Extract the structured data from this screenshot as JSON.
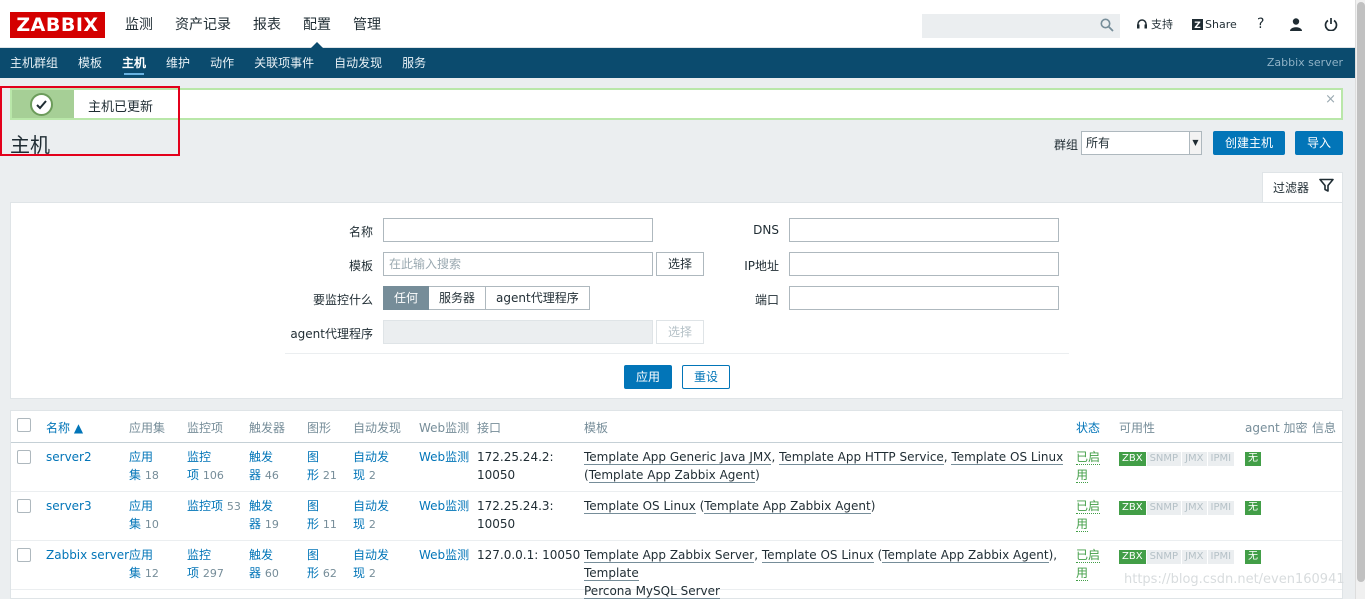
{
  "logo": "ZABBIX",
  "main_menu": [
    "监测",
    "资产记录",
    "报表",
    "配置",
    "管理"
  ],
  "search": {
    "placeholder": ""
  },
  "top_right": {
    "support": "支持",
    "share": "Share",
    "help": "?"
  },
  "sub_menu": [
    "主机群组",
    "模板",
    "主机",
    "维护",
    "动作",
    "关联项事件",
    "自动发现",
    "服务"
  ],
  "server_name": "Zabbix server",
  "message": {
    "text": "主机已更新",
    "close": "×"
  },
  "page": {
    "title": "主机",
    "group_label": "群组",
    "group_value": "所有",
    "create_button": "创建主机",
    "import_button": "导入"
  },
  "filter": {
    "tab_label": "过滤器",
    "name_label": "名称",
    "template_label": "模板",
    "template_placeholder": "在此输入搜索",
    "select_label": "选择",
    "monitored_by_label": "要监控什么",
    "monitored_by_options": [
      "任何",
      "服务器",
      "agent代理程序"
    ],
    "proxy_label": "agent代理程序",
    "dns_label": "DNS",
    "ip_label": "IP地址",
    "port_label": "端口",
    "apply": "应用",
    "reset": "重设"
  },
  "table": {
    "headers": {
      "name": "名称 ▲",
      "apps": "应用集",
      "items": "监控项",
      "triggers": "触发器",
      "graphs": "图形",
      "discovery": "自动发现",
      "web": "Web监测",
      "interface": "接口",
      "templates": "模板",
      "status": "状态",
      "availability": "可用性",
      "encryption": "agent 加密",
      "info": "信息"
    },
    "rows": [
      {
        "name": "server2",
        "apps_a": "应用",
        "apps_b": "集",
        "apps_count": "18",
        "items_a": "监控",
        "items_b": "项",
        "items_count": "106",
        "triggers_a": "触发",
        "triggers_b": "器",
        "triggers_count": "46",
        "graphs_a": "图",
        "graphs_b": "形",
        "graphs_count": "21",
        "disc_a": "自动发",
        "disc_b": "现",
        "disc_count": "2",
        "web": "Web监测",
        "iface_a": "172.25.24.2:",
        "iface_b": "10050",
        "t1": "Template App Generic Java JMX",
        "t2": "Template App HTTP Service",
        "t3": "Template OS Linux",
        "t4": "Template App Zabbix Agent",
        "status_a": "已启",
        "status_b": "用",
        "enc": "无"
      },
      {
        "name": "server3",
        "apps_a": "应用",
        "apps_b": "集",
        "apps_count": "10",
        "items_a": "监控项",
        "items_count": "53",
        "triggers_a": "触发",
        "triggers_b": "器",
        "triggers_count": "19",
        "graphs_a": "图",
        "graphs_b": "形",
        "graphs_count": "11",
        "disc_a": "自动发",
        "disc_b": "现",
        "disc_count": "2",
        "web": "Web监测",
        "iface_a": "172.25.24.3:",
        "iface_b": "10050",
        "t1": "Template OS Linux",
        "t2": "Template App Zabbix Agent",
        "status_a": "已启",
        "status_b": "用",
        "enc": "无"
      },
      {
        "name": "Zabbix server",
        "apps_a": "应用",
        "apps_b": "集",
        "apps_count": "12",
        "items_a": "监控",
        "items_b": "项",
        "items_count": "297",
        "triggers_a": "触发",
        "triggers_b": "器",
        "triggers_count": "60",
        "graphs_a": "图",
        "graphs_b": "形",
        "graphs_count": "62",
        "disc_a": "自动发",
        "disc_b": "现",
        "disc_count": "2",
        "web": "Web监测",
        "iface_a": "127.0.0.1: 10050",
        "t1": "Template App Zabbix Server",
        "t2": "Template OS Linux",
        "t3": "Template App Zabbix Agent",
        "t4a": "Template",
        "t4b": "Percona MySQL Server",
        "status_a": "已启",
        "status_b": "用",
        "enc": "无"
      }
    ],
    "availability": [
      "ZBX",
      "SNMP",
      "JMX",
      "IPMI"
    ]
  },
  "watermark": "https://blog.csdn.net/even160941"
}
